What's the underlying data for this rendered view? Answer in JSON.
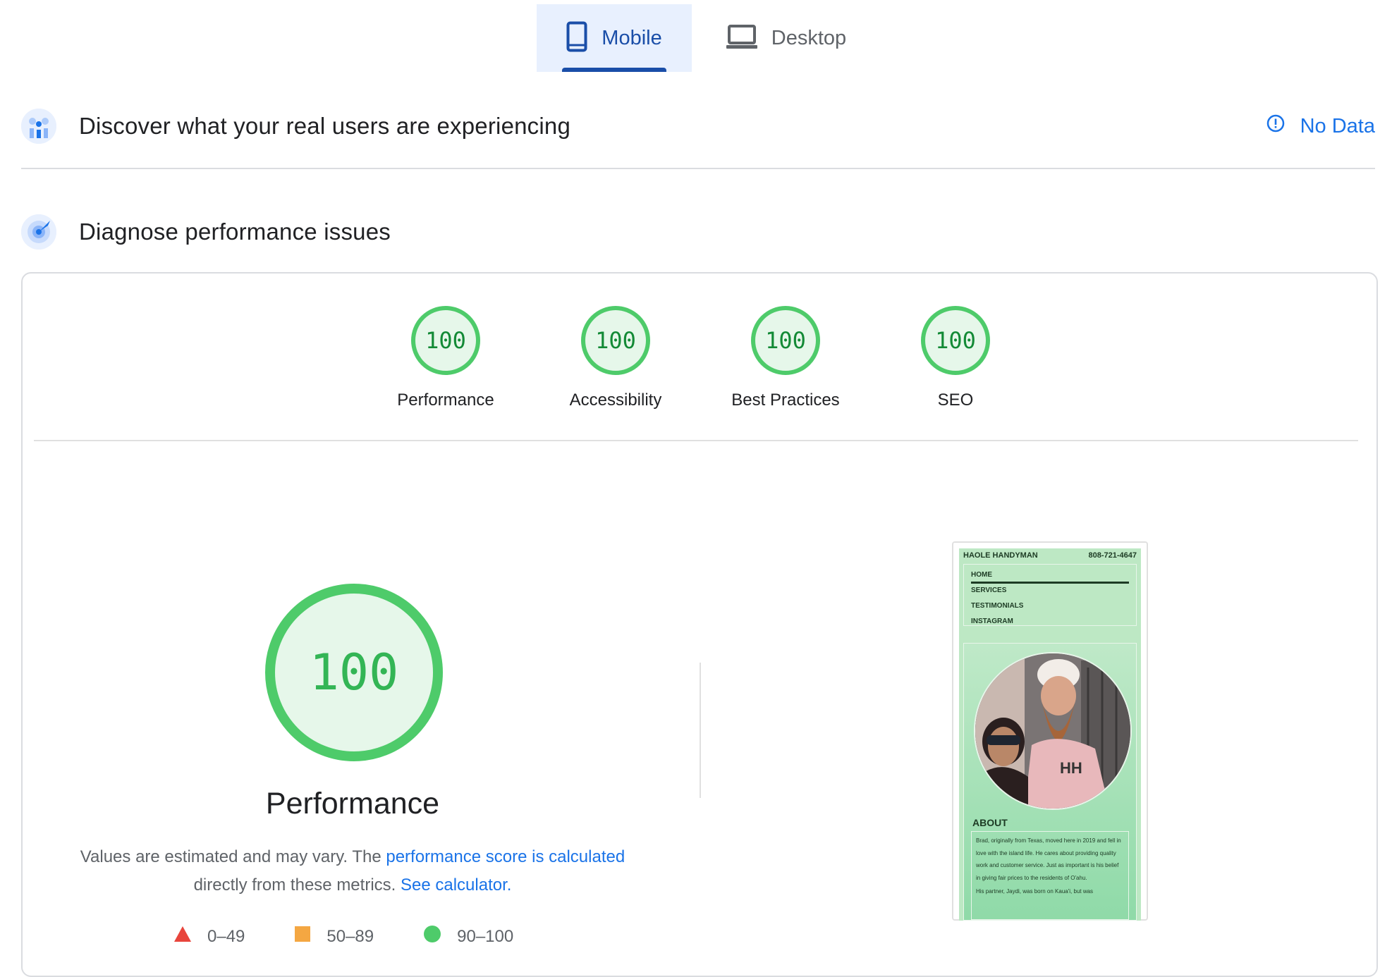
{
  "tabs": {
    "mobile_label": "Mobile",
    "desktop_label": "Desktop",
    "selected": "Mobile",
    "accent_color": "#1a4ea8"
  },
  "field_data": {
    "title": "Discover what your real users are experiencing",
    "status": "No Data",
    "icon": "users-chart-icon",
    "status_icon": "info-icon"
  },
  "lab_data": {
    "title": "Diagnose performance issues",
    "icon": "radar-icon"
  },
  "scores": [
    {
      "label": "Performance",
      "value": "100"
    },
    {
      "label": "Accessibility",
      "value": "100"
    },
    {
      "label": "Best Practices",
      "value": "100"
    },
    {
      "label": "SEO",
      "value": "100"
    }
  ],
  "performance": {
    "score": "100",
    "title": "Performance",
    "desc_prefix": "Values are estimated and may vary. The",
    "desc_link1": "performance score is calculated",
    "desc_middle": "directly from these metrics.",
    "desc_link2": "See calculator.",
    "pass_color": "#4ecb6a"
  },
  "legend": [
    {
      "range": "0–49",
      "shape": "triangle",
      "color": "#e8453c"
    },
    {
      "range": "50–89",
      "shape": "square",
      "color": "#f4a742"
    },
    {
      "range": "90–100",
      "shape": "circle",
      "color": "#4ecb6a"
    }
  ],
  "screenshot": {
    "site_name": "HAOLE HANDYMAN",
    "phone": "808-721-4647",
    "nav": [
      "HOME",
      "SERVICES",
      "TESTIMONIALS",
      "INSTAGRAM"
    ],
    "about_title": "ABOUT",
    "about_text": "Brad, originally from Texas, moved here in 2019 and fell in love with the island life. He cares about providing quality work and customer service. Just as important is his belief in giving fair prices to the residents of O'ahu.",
    "about_text2": "His partner, Jaydi, was born on Kaua'i, but was"
  }
}
